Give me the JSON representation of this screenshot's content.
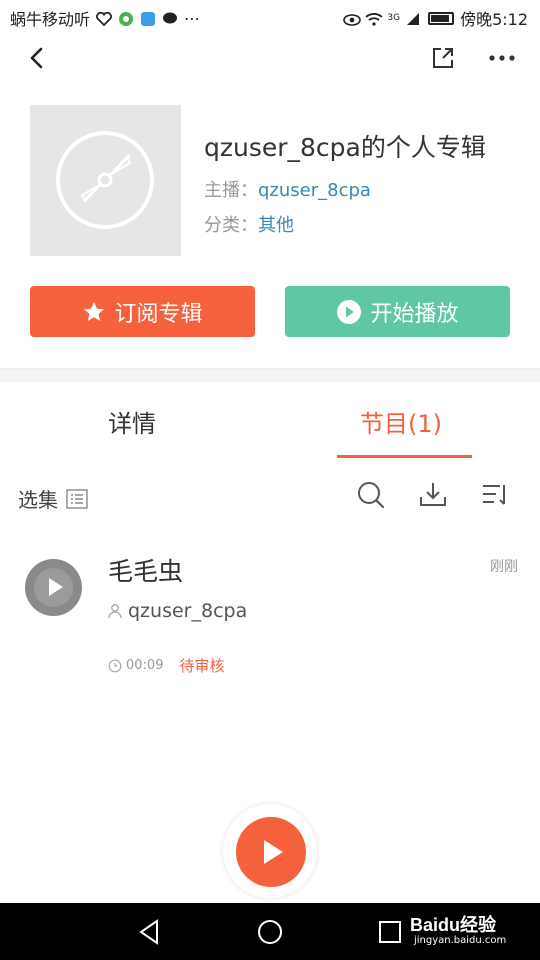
{
  "status_bar": {
    "carrier": "蜗牛移动听",
    "time": "傍晚5:12",
    "network": "3G"
  },
  "album": {
    "title": "qzuser_8cpa的个人专辑",
    "host_label": "主播：",
    "host_value": "qzuser_8cpa",
    "category_label": "分类：",
    "category_value": "其他"
  },
  "actions": {
    "subscribe": "订阅专辑",
    "play": "开始播放"
  },
  "tabs": [
    {
      "label": "详情"
    },
    {
      "label": "节目(1)"
    }
  ],
  "toolbar": {
    "select_label": "选集"
  },
  "tracks": [
    {
      "title": "毛毛虫",
      "author": "qzuser_8cpa",
      "duration": "00:09",
      "status": "待审核",
      "time_ago": "刚刚"
    }
  ],
  "watermark": {
    "brand": "Baidu经验",
    "url": "jingyan.baidu.com"
  },
  "colors": {
    "accent": "#f5603d",
    "play_green": "#5fc7a4",
    "link_blue": "#3a87b8"
  }
}
